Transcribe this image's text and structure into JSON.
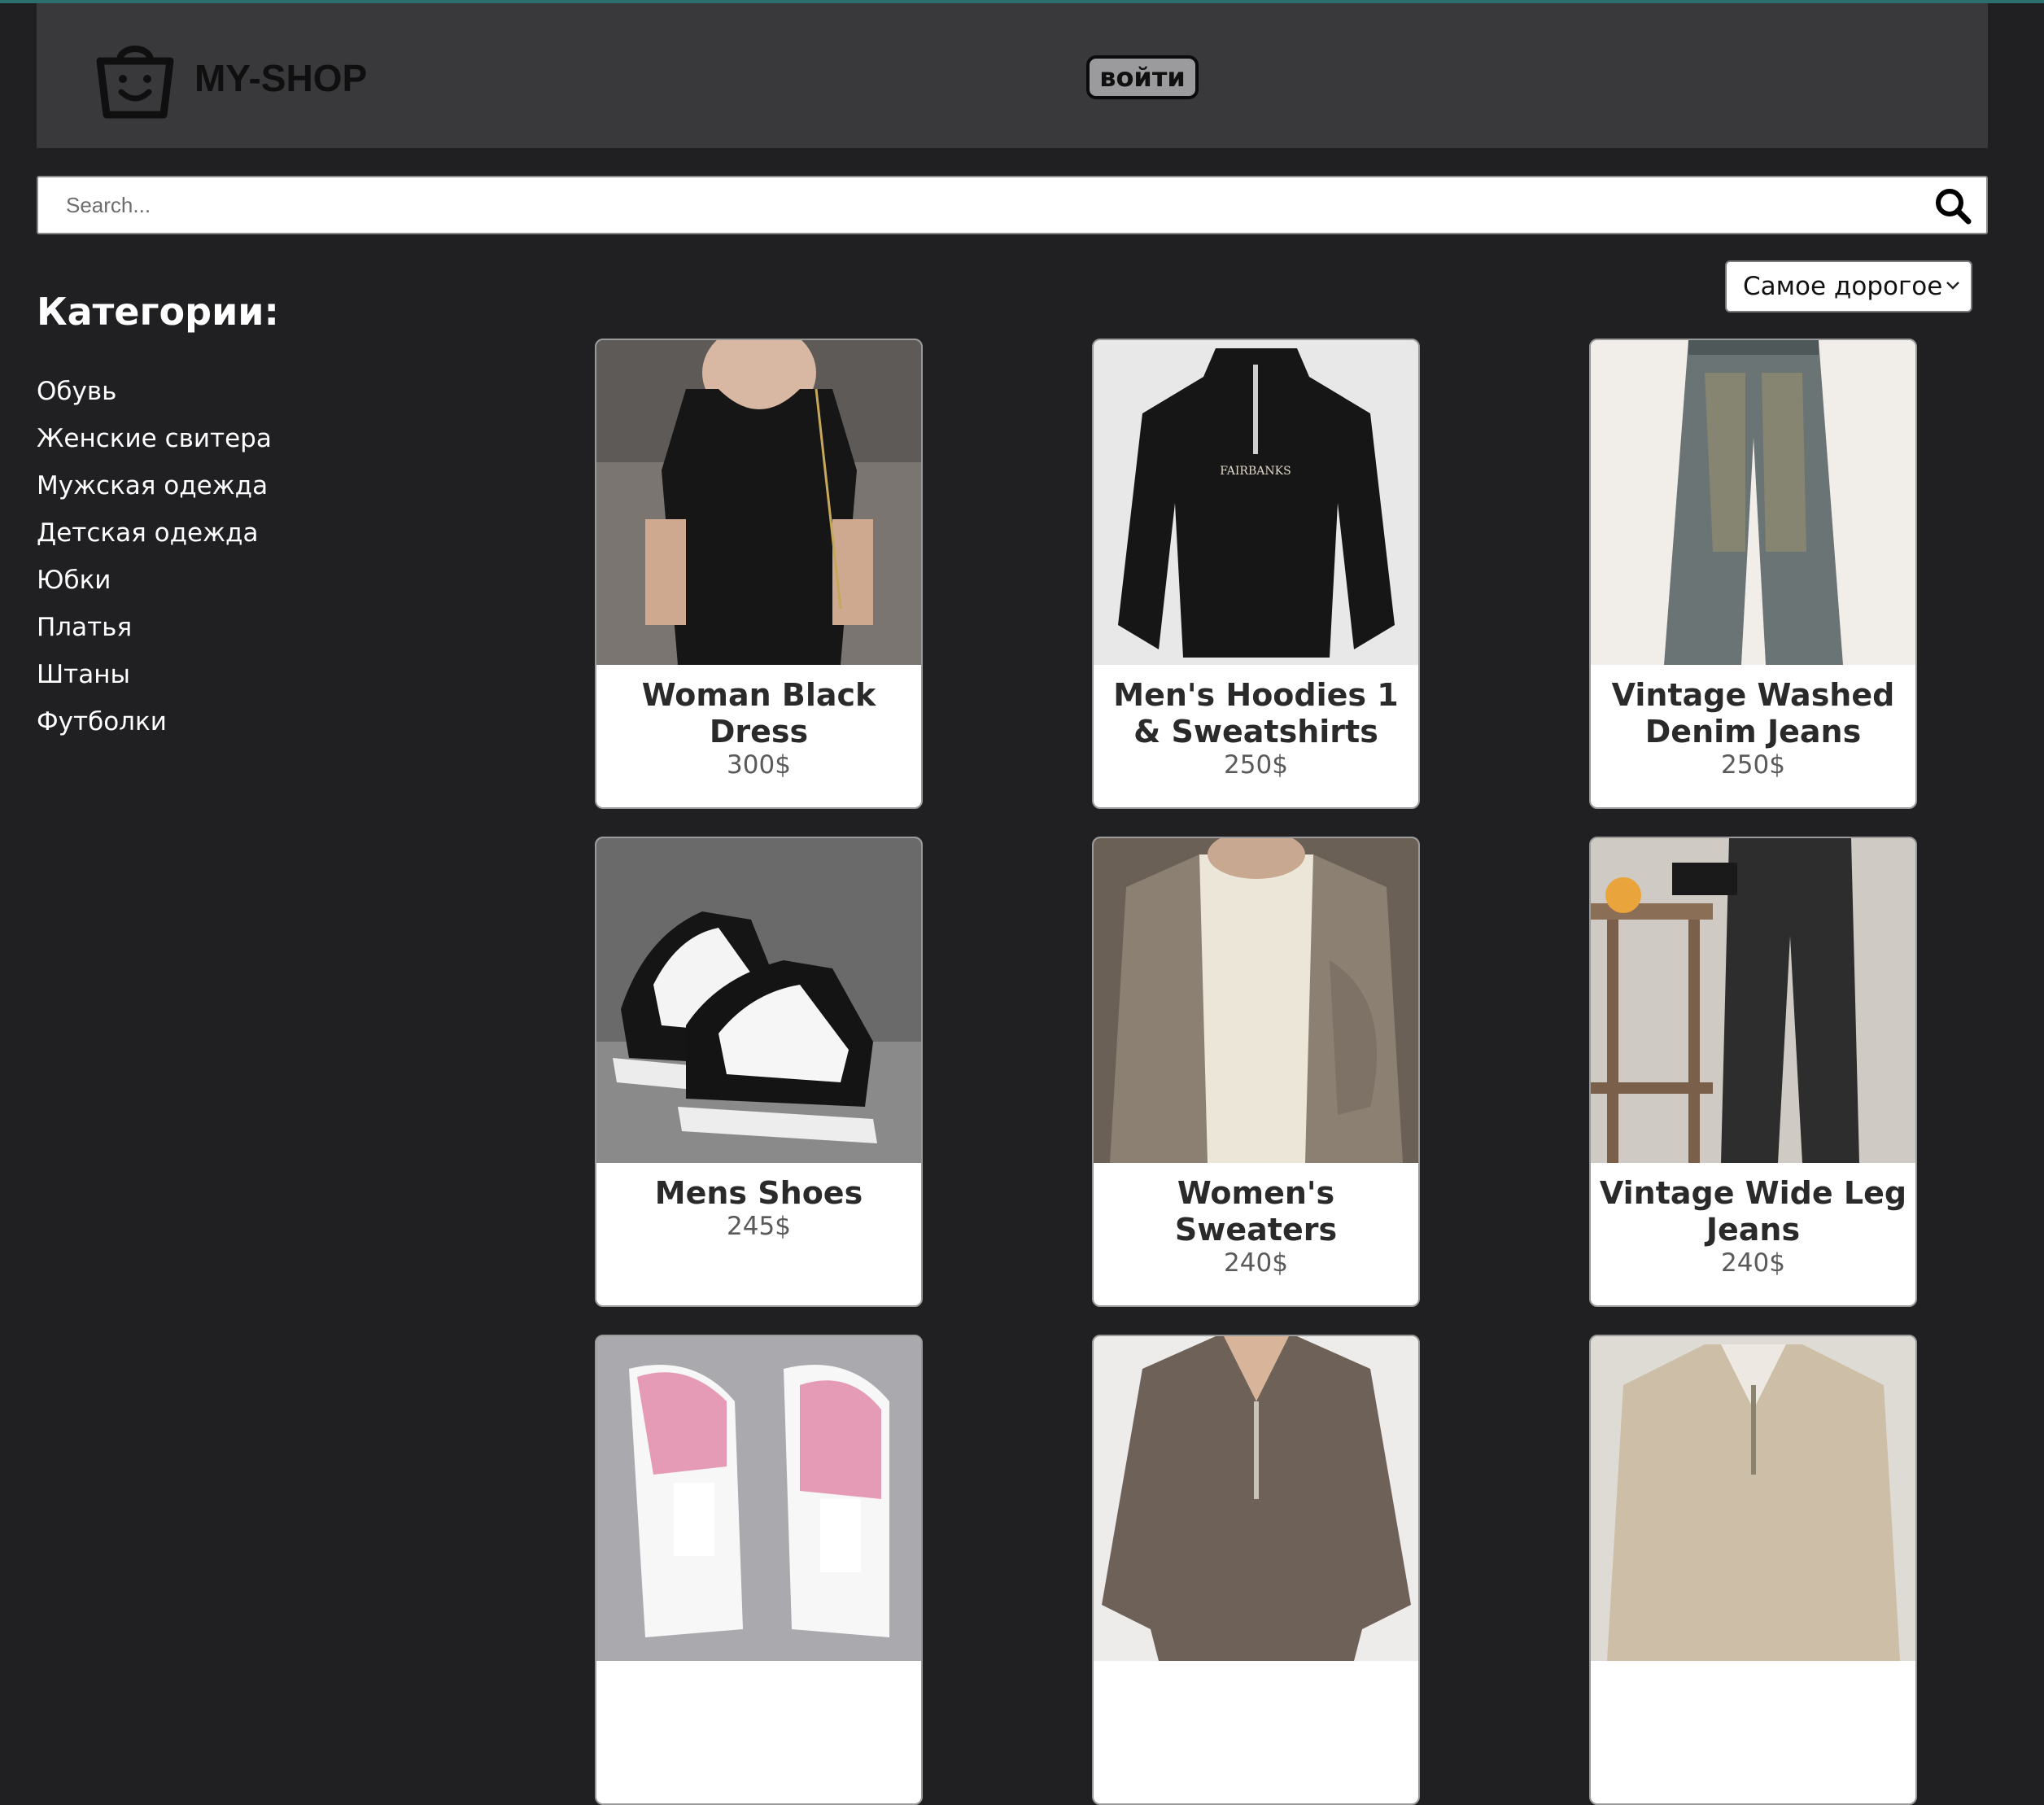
{
  "header": {
    "logo_text": "MY-SHOP",
    "login_label": "войти"
  },
  "search": {
    "placeholder": "Search...",
    "value": ""
  },
  "sort": {
    "selected": "Самое дорогое"
  },
  "categories": {
    "title": "Категории:",
    "items": [
      {
        "label": "Обувь"
      },
      {
        "label": "Женские свитера"
      },
      {
        "label": "Мужская одежда"
      },
      {
        "label": "Детская одежда"
      },
      {
        "label": "Юбки"
      },
      {
        "label": "Платья"
      },
      {
        "label": "Штаны"
      },
      {
        "label": "Футболки"
      }
    ]
  },
  "products": [
    {
      "name": "Woman Black Dress",
      "price": "300$",
      "icon": "black-dress-photo"
    },
    {
      "name": "Men's Hoodies 1 & Sweatshirts",
      "price": "250$",
      "icon": "black-sweatshirt-photo"
    },
    {
      "name": "Vintage Washed Denim Jeans",
      "price": "250$",
      "icon": "washed-jeans-photo"
    },
    {
      "name": "Mens Shoes",
      "price": "245$",
      "icon": "black-white-sneakers-photo"
    },
    {
      "name": "Women's Sweaters",
      "price": "240$",
      "icon": "cardigan-photo"
    },
    {
      "name": "Vintage Wide Leg Jeans",
      "price": "240$",
      "icon": "wide-leg-jeans-photo"
    },
    {
      "name": "",
      "price": "",
      "icon": "pink-sneakers-photo"
    },
    {
      "name": "",
      "price": "",
      "icon": "brown-zip-sweater-photo"
    },
    {
      "name": "",
      "price": "",
      "icon": "beige-zip-sweater-photo"
    }
  ],
  "colors": {
    "page_bg": "#202023",
    "header_bg": "#39393c",
    "accent_strip": "#2b6f6f",
    "card_bg": "#ffffff"
  }
}
